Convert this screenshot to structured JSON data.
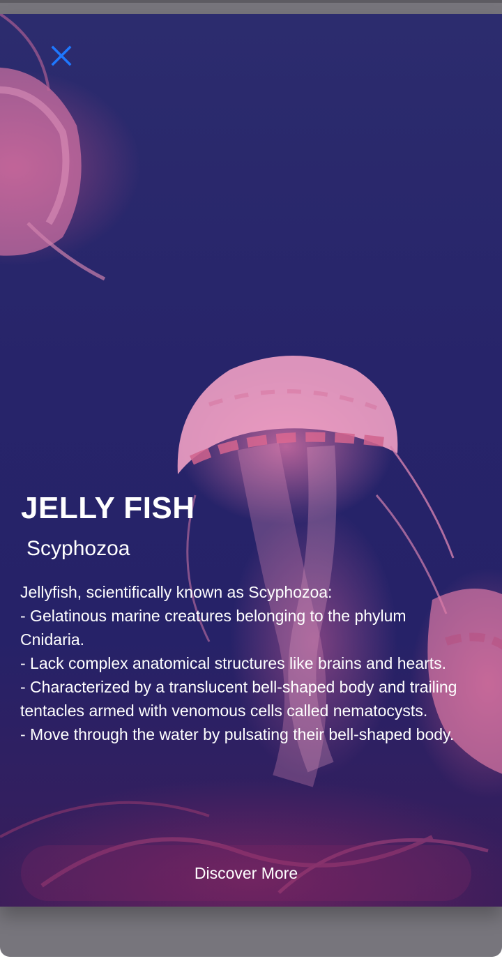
{
  "header": {
    "close_icon": "close-icon"
  },
  "content": {
    "title": "JELLY FISH",
    "subtitle": "Scyphozoa",
    "description": [
      "Jellyfish, scientifically known as Scyphozoa:",
      "- Gelatinous marine creatures belonging to the phylum Cnidaria.",
      "- Lack complex anatomical structures like brains and hearts.",
      "- Characterized by a translucent bell-shaped body and trailing tentacles armed with venomous cells called nematocysts.",
      "- Move through the water by pulsating their bell-shaped body."
    ]
  },
  "actions": {
    "discover_label": "Discover More"
  },
  "colors": {
    "accent": "#1e78ff",
    "card_background": "#272468",
    "jellyfish_pink": "#e878aa",
    "backdrop": "#77757c"
  }
}
